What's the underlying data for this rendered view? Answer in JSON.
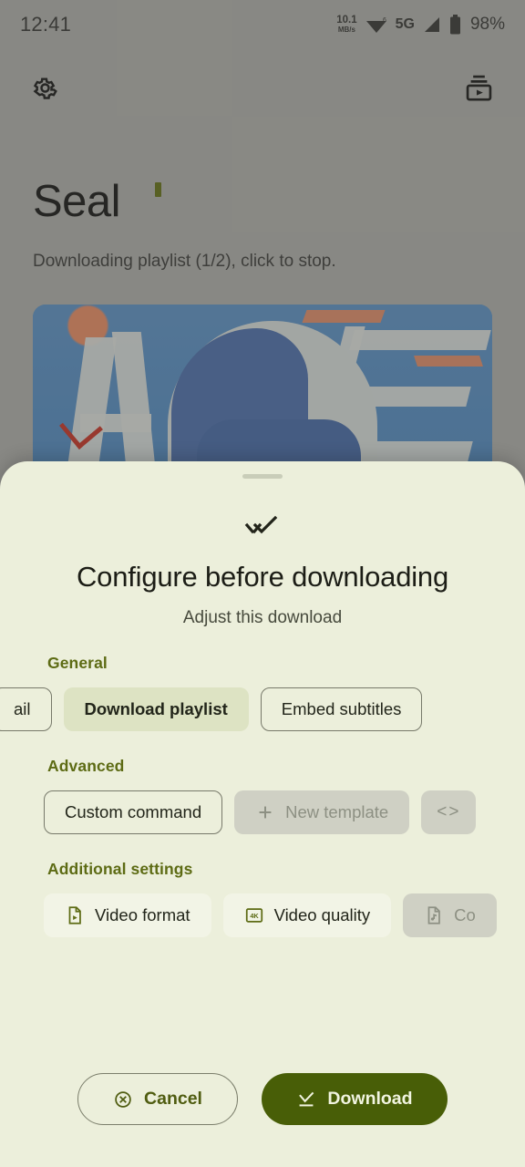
{
  "status_bar": {
    "clock": "12:41",
    "net_speed_value": "10.1",
    "net_speed_unit": "MB/s",
    "wifi_icon": "wifi-6-icon",
    "network_label": "5G",
    "signal_icon": "signal-bars-icon",
    "battery_icon": "battery-icon",
    "battery_percent": "98%"
  },
  "top_bar": {
    "settings_icon": "gear-icon",
    "downloads_icon": "video-playlist-icon"
  },
  "app": {
    "title": "Seal",
    "subtitle": "Downloading playlist (1/2), click to stop.",
    "thumbnail_name": "video-thumbnail"
  },
  "sheet": {
    "handle": "drag-handle",
    "header_icon": "done-all-icon",
    "title": "Configure before downloading",
    "subtitle": "Adjust this download",
    "sections": [
      {
        "label": "General",
        "chips": [
          {
            "label": "ail",
            "state": "outlined-clipped",
            "icon": null
          },
          {
            "label": "Download playlist",
            "state": "selected",
            "icon": null
          },
          {
            "label": "Embed subtitles",
            "state": "outlined",
            "icon": null
          }
        ]
      },
      {
        "label": "Advanced",
        "chips": [
          {
            "label": "Custom command",
            "state": "outlined",
            "icon": null
          },
          {
            "label": "New template",
            "state": "disabled",
            "icon": "plus-icon"
          },
          {
            "label": "<>",
            "state": "disabled-icon-only",
            "icon": "code-icon"
          }
        ]
      },
      {
        "label": "Additional settings",
        "chips": [
          {
            "label": "Video format",
            "state": "soft",
            "icon": "video-file-icon"
          },
          {
            "label": "Video quality",
            "state": "soft",
            "icon": "4k-icon"
          },
          {
            "label": "Co",
            "state": "disabled",
            "icon": "audio-file-icon"
          }
        ]
      }
    ],
    "cancel_label": "Cancel",
    "cancel_icon": "cancel-circle-icon",
    "download_label": "Download",
    "download_icon": "download-icon"
  },
  "colors": {
    "sheet_background": "#ecefdb",
    "accent_olive": "#5d6b14",
    "download_button": "#485e07",
    "selected_chip": "#dde3c3",
    "disabled_chip": "#cfd0c4",
    "app_background": "#aaaaa5"
  }
}
